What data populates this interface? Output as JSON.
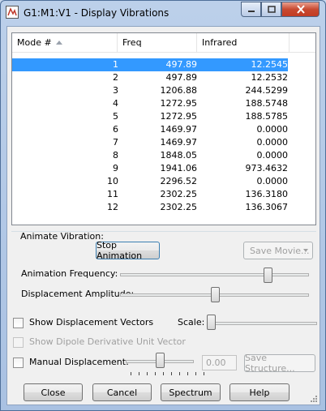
{
  "window": {
    "title": "G1:M1:V1 - Display Vibrations"
  },
  "list": {
    "columns": {
      "mode": "Mode #",
      "freq": "Freq",
      "infrared": "Infrared"
    },
    "rows": [
      {
        "mode": "1",
        "freq": "497.89",
        "infrared": "12.2545"
      },
      {
        "mode": "2",
        "freq": "497.89",
        "infrared": "12.2532"
      },
      {
        "mode": "3",
        "freq": "1206.88",
        "infrared": "244.5299"
      },
      {
        "mode": "4",
        "freq": "1272.95",
        "infrared": "188.5748"
      },
      {
        "mode": "5",
        "freq": "1272.95",
        "infrared": "188.5785"
      },
      {
        "mode": "6",
        "freq": "1469.97",
        "infrared": "0.0000"
      },
      {
        "mode": "7",
        "freq": "1469.97",
        "infrared": "0.0000"
      },
      {
        "mode": "8",
        "freq": "1848.05",
        "infrared": "0.0000"
      },
      {
        "mode": "9",
        "freq": "1941.06",
        "infrared": "973.4632"
      },
      {
        "mode": "10",
        "freq": "2296.52",
        "infrared": "0.0000"
      },
      {
        "mode": "11",
        "freq": "2302.25",
        "infrared": "136.3180"
      },
      {
        "mode": "12",
        "freq": "2302.25",
        "infrared": "136.3067"
      }
    ],
    "selected_row": 1
  },
  "animate": {
    "group_label": "Animate Vibration:",
    "stop_button": "Stop Animation",
    "save_movie_button": "Save Movie...",
    "frequency_label": "Animation Frequency:",
    "frequency_level": 0.78,
    "amplitude_label": "Displacement Amplitude:",
    "amplitude_level": 0.5
  },
  "options": {
    "show_vectors_label": "Show Displacement Vectors",
    "scale_label": "Scale:",
    "scale_level": 0.02,
    "dipole_label": "Show Dipole Derivative Unit Vector",
    "manual_label": "Manual Displacement:",
    "manual_level": 0.5,
    "manual_value": "0.00",
    "save_structure_button": "Save Structure..."
  },
  "buttons": {
    "close": "Close",
    "cancel": "Cancel",
    "spectrum": "Spectrum",
    "help": "Help"
  },
  "colors": {
    "selection": "#3399ff"
  }
}
